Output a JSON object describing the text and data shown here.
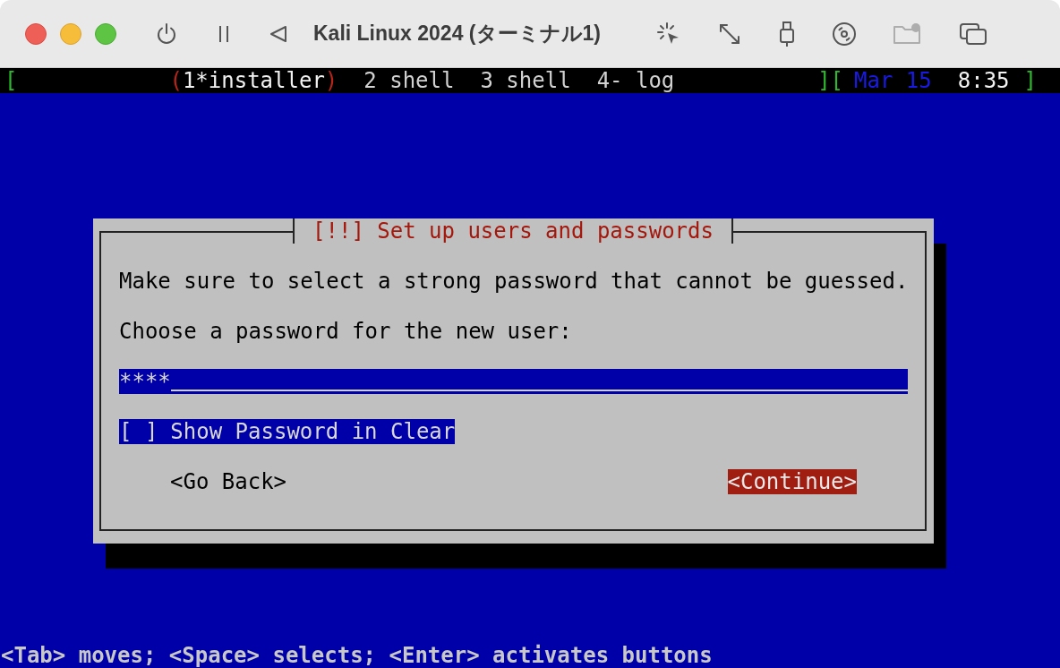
{
  "window": {
    "title": "Kali Linux 2024 (ターミナル1)"
  },
  "toolbar": [
    {
      "kind": "power"
    },
    {
      "kind": "pause"
    },
    {
      "kind": "back"
    },
    {
      "kind": "capture"
    },
    {
      "kind": "resize"
    },
    {
      "kind": "usb"
    },
    {
      "kind": "disc"
    },
    {
      "kind": "folder",
      "disabled": true
    },
    {
      "kind": "windows"
    }
  ],
  "status_bar": {
    "brackets": [
      "[",
      "][",
      "]"
    ],
    "selected_marks": [
      "(",
      ")"
    ],
    "windows": [
      {
        "label": "1*installer",
        "selected": true
      },
      {
        "label": "2 shell",
        "selected": false
      },
      {
        "label": "3 shell",
        "selected": false
      },
      {
        "label": "4- log",
        "selected": false
      }
    ],
    "date": "Mar 15",
    "time": "8:35"
  },
  "dialog": {
    "title": "[!!] Set up users and passwords",
    "message": "Make sure to select a strong password that cannot be guessed.",
    "prompt": "Choose a password for the new user:",
    "password": {
      "value": "****"
    },
    "checkbox": {
      "box": "[ ]",
      "label": "Show Password in Clear",
      "checked": false,
      "focused": true
    },
    "buttons": [
      {
        "label": "<Go Back>",
        "selected": false
      },
      {
        "label": "<Continue>",
        "selected": true
      }
    ]
  },
  "help": "<Tab> moves; <Space> selects; <Enter> activates buttons"
}
